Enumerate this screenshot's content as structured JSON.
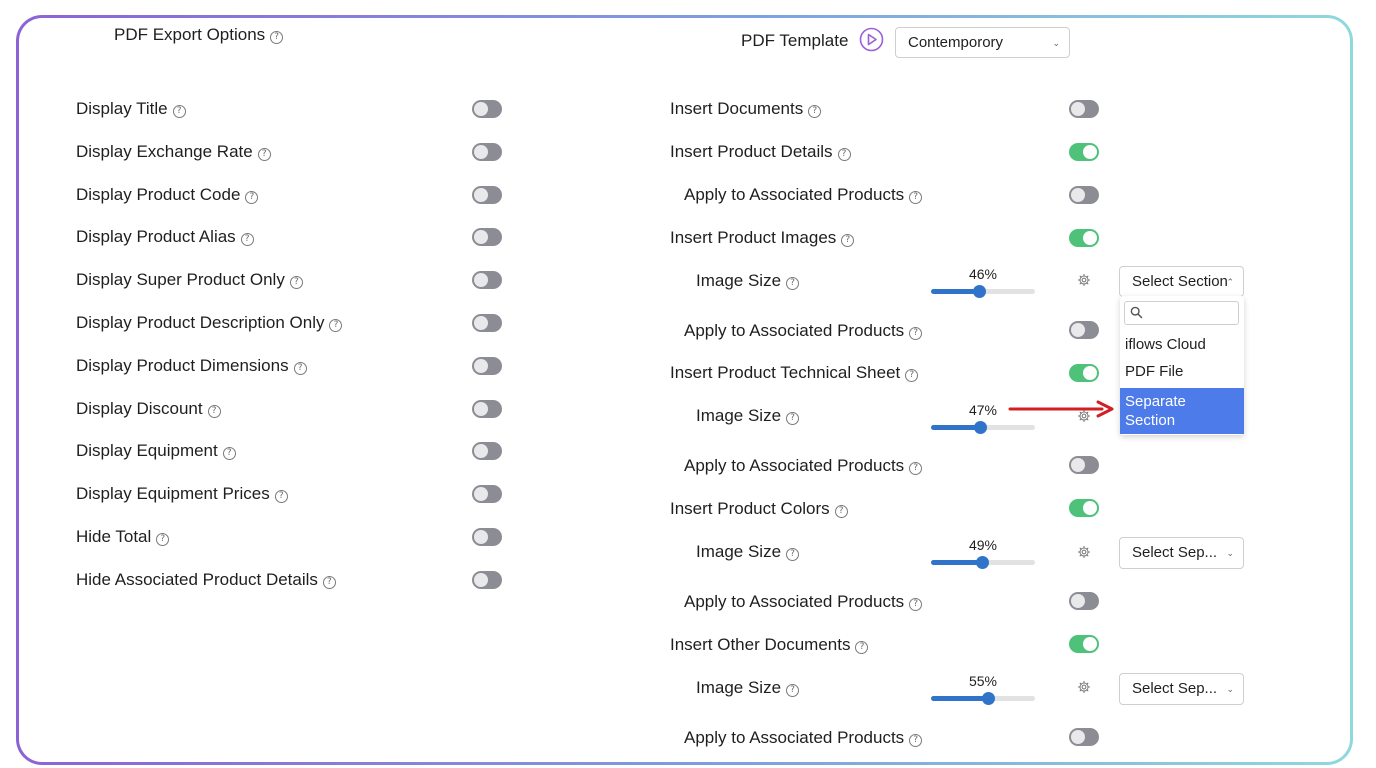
{
  "header": {
    "export_options_title": "PDF Export Options",
    "template_label": "PDF Template",
    "template_value": "Contemporory"
  },
  "help_glyph": "?",
  "left_options": [
    {
      "label": "Display Title",
      "on": false
    },
    {
      "label": "Display Exchange Rate",
      "on": false
    },
    {
      "label": "Display Product Code",
      "on": false
    },
    {
      "label": "Display Product Alias",
      "on": false
    },
    {
      "label": "Display Super Product Only",
      "on": false
    },
    {
      "label": "Display Product Description Only",
      "on": false
    },
    {
      "label": "Display Product Dimensions",
      "on": false
    },
    {
      "label": "Display Discount",
      "on": false
    },
    {
      "label": "Display Equipment",
      "on": false
    },
    {
      "label": "Display Equipment Prices",
      "on": false
    },
    {
      "label": "Hide Total",
      "on": false
    },
    {
      "label": "Hide Associated Product Details",
      "on": false
    }
  ],
  "right_options": {
    "insert_documents": {
      "label": "Insert Documents",
      "on": false
    },
    "insert_product_details": {
      "label": "Insert Product Details",
      "on": true
    },
    "apply_1": {
      "label": "Apply to Associated Products",
      "on": false
    },
    "insert_product_images": {
      "label": "Insert Product Images",
      "on": true
    },
    "image_size_1": {
      "label": "Image Size",
      "value": 46,
      "value_text": "46%",
      "section": "Select Section"
    },
    "apply_2": {
      "label": "Apply to Associated Products",
      "on": false
    },
    "insert_technical_sheet": {
      "label": "Insert Product Technical Sheet",
      "on": true
    },
    "image_size_2": {
      "label": "Image Size",
      "value": 47,
      "value_text": "47%"
    },
    "apply_3": {
      "label": "Apply to Associated Products",
      "on": false
    },
    "insert_product_colors": {
      "label": "Insert Product Colors",
      "on": true
    },
    "image_size_3": {
      "label": "Image Size",
      "value": 49,
      "value_text": "49%",
      "section": "Select Sep..."
    },
    "apply_4": {
      "label": "Apply to Associated Products",
      "on": false
    },
    "insert_other_documents": {
      "label": "Insert Other Documents",
      "on": true
    },
    "image_size_4": {
      "label": "Image Size",
      "value": 55,
      "value_text": "55%",
      "section": "Select Sep..."
    },
    "apply_5": {
      "label": "Apply to Associated Products",
      "on": false
    }
  },
  "section_dropdown": {
    "options": [
      "iflows Cloud",
      "PDF File"
    ],
    "selected": "Separate Section"
  },
  "colors": {
    "toggle_on": "#4fc27a",
    "toggle_off": "#8c8c94",
    "slider": "#2f74c9",
    "dropdown_selected": "#4e7bea",
    "annotation_arrow": "#d11f25",
    "play_icon": "#9b5fd6"
  }
}
